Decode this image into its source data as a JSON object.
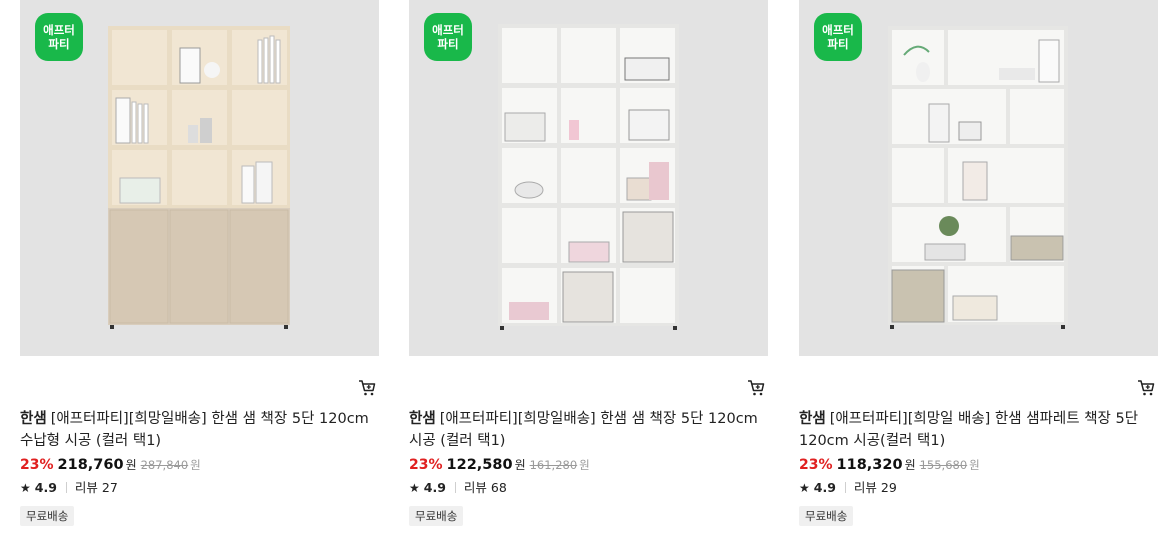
{
  "products": [
    {
      "badge_line1": "애프터",
      "badge_line2": "파티",
      "brand": "한샘",
      "name": "[애프터파티][희망일배송] 한샘 샘 책장 5단 120cm 수납형 시공 (컬러 택1)",
      "discount": "23%",
      "price": "218,760",
      "currency": "원",
      "original_price": "287,840",
      "rating": "4.9",
      "review_label": "리뷰 27",
      "shipping_tag": "무료배송",
      "image_icon": "bookshelf-with-cabinet-image"
    },
    {
      "badge_line1": "애프터",
      "badge_line2": "파티",
      "brand": "한샘",
      "name": "[애프터파티][희망일배송] 한샘 샘 책장 5단 120cm 시공 (컬러 택1)",
      "discount": "23%",
      "price": "122,580",
      "currency": "원",
      "original_price": "161,280",
      "rating": "4.9",
      "review_label": "리뷰 68",
      "shipping_tag": "무료배송",
      "image_icon": "cube-bookshelf-image"
    },
    {
      "badge_line1": "애프터",
      "badge_line2": "파티",
      "brand": "한샘",
      "name": "[애프터파티][희망일 배송] 한샘 샘파레트 책장 5단 120cm 시공(컬러 택1)",
      "discount": "23%",
      "price": "118,320",
      "currency": "원",
      "original_price": "155,680",
      "rating": "4.9",
      "review_label": "리뷰 29",
      "shipping_tag": "무료배송",
      "image_icon": "staggered-bookshelf-image"
    }
  ],
  "icons": {
    "cart": "cart-icon",
    "star": "star-icon"
  },
  "colors": {
    "badge": "#19b84a",
    "discount": "#e02020",
    "thumb_bg": "#e3e3e3"
  }
}
